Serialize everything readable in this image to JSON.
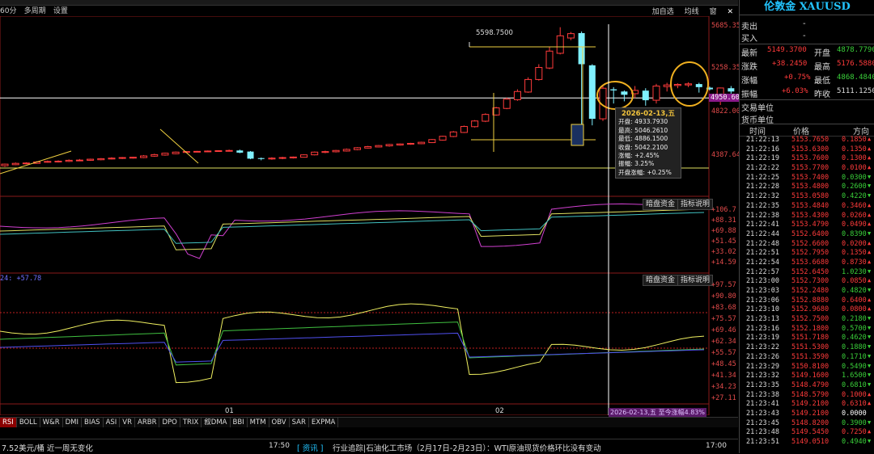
{
  "toolbar": {
    "period": "60分",
    "multi_period": "多周期",
    "settings": "设置",
    "add_select": "加自选",
    "ma_line": "均线",
    "window": "窗"
  },
  "quote": {
    "title": "伦敦金 XAUUSD",
    "sell_label": "卖出",
    "sell_value": "-",
    "buy_label": "买入",
    "buy_value": "-",
    "latest_label": "最新",
    "latest_value": "5149.3700",
    "open_label": "开盘",
    "open_value": "4878.7790",
    "change_label": "涨跌",
    "change_value": "+38.2450",
    "high_label": "最高",
    "high_value": "5176.5880",
    "pct_label": "涨幅",
    "pct_value": "+0.75%",
    "low_label": "最低",
    "low_value": "4868.4840",
    "amp_label": "振幅",
    "amp_value": "+6.03%",
    "prev_label": "昨收",
    "prev_value": "5111.1250",
    "unit_trade_label": "交易单位",
    "unit_currency_label": "货币单位"
  },
  "ticks_header": {
    "time": "时间",
    "price": "价格",
    "dir": "方向"
  },
  "ticks": [
    {
      "time": "21:22:13",
      "price": "5153.7650",
      "vol": "0.1850",
      "up": true
    },
    {
      "time": "21:22:16",
      "price": "5153.6300",
      "vol": "0.1350",
      "up": true
    },
    {
      "time": "21:22:19",
      "price": "5153.7600",
      "vol": "0.1300",
      "up": true
    },
    {
      "time": "21:22:22",
      "price": "5153.7700",
      "vol": "0.0100",
      "up": true
    },
    {
      "time": "21:22:25",
      "price": "5153.7400",
      "vol": "0.0300",
      "up": false
    },
    {
      "time": "21:22:28",
      "price": "5153.4800",
      "vol": "0.2600",
      "up": false
    },
    {
      "time": "21:22:32",
      "price": "5153.0580",
      "vol": "0.4220",
      "up": false
    },
    {
      "time": "21:22:35",
      "price": "5153.4840",
      "vol": "0.3460",
      "up": true
    },
    {
      "time": "21:22:38",
      "price": "5153.4300",
      "vol": "0.0260",
      "up": true
    },
    {
      "time": "21:22:41",
      "price": "5153.4790",
      "vol": "0.0490",
      "up": true
    },
    {
      "time": "21:22:44",
      "price": "5152.6400",
      "vol": "0.8390",
      "up": false
    },
    {
      "time": "21:22:48",
      "price": "5152.6600",
      "vol": "0.0200",
      "up": true
    },
    {
      "time": "21:22:51",
      "price": "5152.7950",
      "vol": "0.1350",
      "up": true
    },
    {
      "time": "21:22:54",
      "price": "5153.6680",
      "vol": "0.8730",
      "up": true
    },
    {
      "time": "21:22:57",
      "price": "5152.6450",
      "vol": "1.0230",
      "up": false
    },
    {
      "time": "21:23:00",
      "price": "5152.7300",
      "vol": "0.0850",
      "up": true
    },
    {
      "time": "21:23:03",
      "price": "5152.2480",
      "vol": "0.4820",
      "up": false
    },
    {
      "time": "21:23:06",
      "price": "5152.8880",
      "vol": "0.6400",
      "up": true
    },
    {
      "time": "21:23:10",
      "price": "5152.9680",
      "vol": "0.0800",
      "up": true
    },
    {
      "time": "21:23:13",
      "price": "5152.7500",
      "vol": "0.2180",
      "up": false
    },
    {
      "time": "21:23:16",
      "price": "5152.1800",
      "vol": "0.5700",
      "up": false
    },
    {
      "time": "21:23:19",
      "price": "5151.7180",
      "vol": "0.4620",
      "up": false
    },
    {
      "time": "21:23:22",
      "price": "5151.5300",
      "vol": "0.1880",
      "up": false
    },
    {
      "time": "21:23:26",
      "price": "5151.3590",
      "vol": "0.1710",
      "up": false
    },
    {
      "time": "21:23:29",
      "price": "5150.8100",
      "vol": "0.5490",
      "up": false
    },
    {
      "time": "21:23:32",
      "price": "5149.1600",
      "vol": "1.6500",
      "up": false
    },
    {
      "time": "21:23:35",
      "price": "5148.4790",
      "vol": "0.6810",
      "up": false
    },
    {
      "time": "21:23:38",
      "price": "5148.5790",
      "vol": "0.1000",
      "up": true
    },
    {
      "time": "21:23:41",
      "price": "5149.2100",
      "vol": "0.6310",
      "up": true
    },
    {
      "time": "21:23:43",
      "price": "5149.2100",
      "vol": "0.0000",
      "up": null
    },
    {
      "time": "21:23:45",
      "price": "5148.8200",
      "vol": "0.3900",
      "up": false
    },
    {
      "time": "21:23:48",
      "price": "5149.5450",
      "vol": "0.7250",
      "up": true
    },
    {
      "time": "21:23:51",
      "price": "5149.0510",
      "vol": "0.4940",
      "up": false
    }
  ],
  "price_axis": [
    "5685.353",
    "5258.356",
    "4950.605",
    "4822.001",
    "4387.643"
  ],
  "annotations": {
    "peak_label": "5598.7500"
  },
  "tooltip": {
    "date": "2026-02-13,五",
    "open": "开盘: 4933.7930",
    "high": "最高: 5046.2610",
    "low": "最低: 4886.1500",
    "close": "收盘: 5042.2100",
    "change": "涨幅: +2.45%",
    "amp": "振幅: 3.25%",
    "open_change": "开盘涨幅: +0.25%"
  },
  "panel2": {
    "btn1": "暗盘资金",
    "btn2": "指标说明",
    "axis": [
      "+106.7",
      "+88.31",
      "+69.88",
      "+51.45",
      "+33.02",
      "+14.59"
    ]
  },
  "panel3": {
    "btn1": "暗盘资金",
    "btn2": "指标说明",
    "label": "24: +57.78",
    "axis": [
      "+97.57",
      "+90.80",
      "+83.68",
      "+75.57",
      "+69.46",
      "+62.34",
      "+55.57",
      "+48.45",
      "+41.34",
      "+34.23",
      "+27.11"
    ]
  },
  "x_axis": {
    "l1": "01",
    "l2": "02",
    "cursor_label": "2026-02-13,五 至今涨幅4.83%"
  },
  "indicator_tabs": [
    "RSI",
    "BOLL",
    "W&R",
    "DMI",
    "BIAS",
    "ASI",
    "VR",
    "ARBR",
    "DPO",
    "TRIX",
    "叙DMA",
    "BBI",
    "MTM",
    "OBV",
    "SAR",
    "EXPMA"
  ],
  "news": {
    "left": "7.52美元/桶  近一周无变化",
    "time": "17:50",
    "tag": "[ 资讯 ]",
    "text": "行业追踪|石油化工市场（2月17日-2月23日）：WTI原油现货价格环比没有变动",
    "right_time": "17:00"
  },
  "colors": {
    "up": "#ff3b3b",
    "down": "#3ad13a",
    "bear_candle": "#7ff0ff",
    "accent": "#22c4ff",
    "yellow": "#f0d040",
    "purple": "#c040c0"
  },
  "chart_data": {
    "type": "candlestick",
    "title": "伦敦金 XAUUSD",
    "ylim": [
      4250,
      5700
    ],
    "candles": [
      [
        4330,
        4345,
        4320,
        4350
      ],
      [
        4340,
        4352,
        4335,
        4360
      ],
      [
        4348,
        4355,
        4345,
        4362
      ],
      [
        4352,
        4365,
        4348,
        4372
      ],
      [
        4362,
        4370,
        4358,
        4378
      ],
      [
        4368,
        4372,
        4360,
        4380
      ],
      [
        4370,
        4380,
        4365,
        4388
      ],
      [
        4378,
        4382,
        4372,
        4392
      ],
      [
        4380,
        4390,
        4375,
        4395
      ],
      [
        4385,
        4395,
        4380,
        4400
      ],
      [
        4392,
        4400,
        4388,
        4408
      ],
      [
        4398,
        4405,
        4392,
        4410
      ],
      [
        4400,
        4408,
        4395,
        4412
      ],
      [
        4405,
        4420,
        4400,
        4428
      ],
      [
        4418,
        4432,
        4412,
        4440
      ],
      [
        4428,
        4445,
        4422,
        4450
      ],
      [
        4440,
        4455,
        4435,
        4460
      ],
      [
        4452,
        4460,
        4448,
        4465
      ],
      [
        4458,
        4462,
        4455,
        4466
      ],
      [
        4460,
        4465,
        4455,
        4470
      ],
      [
        4462,
        4468,
        4458,
        4472
      ],
      [
        4465,
        4470,
        4460,
        4478
      ],
      [
        4470,
        4450,
        4445,
        4478
      ],
      [
        4460,
        4395,
        4390,
        4465
      ],
      [
        4400,
        4392,
        4380,
        4405
      ],
      [
        4392,
        4400,
        4385,
        4408
      ],
      [
        4398,
        4405,
        4390,
        4412
      ],
      [
        4402,
        4410,
        4396,
        4415
      ],
      [
        4408,
        4430,
        4405,
        4435
      ],
      [
        4430,
        4455,
        4425,
        4460
      ],
      [
        4452,
        4460,
        4445,
        4468
      ],
      [
        4458,
        4470,
        4452,
        4475
      ],
      [
        4465,
        4480,
        4460,
        4488
      ],
      [
        4478,
        4495,
        4472,
        4500
      ],
      [
        4492,
        4505,
        4488,
        4512
      ],
      [
        4502,
        4515,
        4498,
        4520
      ],
      [
        4512,
        4525,
        4505,
        4530
      ],
      [
        4520,
        4530,
        4515,
        4535
      ],
      [
        4528,
        4535,
        4522,
        4540
      ],
      [
        4532,
        4545,
        4528,
        4550
      ],
      [
        4542,
        4570,
        4538,
        4575
      ],
      [
        4565,
        4600,
        4560,
        4605
      ],
      [
        4598,
        4640,
        4592,
        4648
      ],
      [
        4635,
        4690,
        4630,
        4698
      ],
      [
        4688,
        4740,
        4680,
        4748
      ],
      [
        4738,
        4800,
        4730,
        4810
      ],
      [
        4795,
        4860,
        4788,
        4870
      ],
      [
        4855,
        4940,
        4848,
        4955
      ],
      [
        4935,
        5010,
        4925,
        5030
      ],
      [
        5005,
        5120,
        4998,
        5140
      ],
      [
        5120,
        5230,
        5110,
        5260
      ],
      [
        5225,
        5380,
        5215,
        5420
      ],
      [
        5360,
        5520,
        5350,
        5598.75
      ],
      [
        5500,
        5540,
        5480,
        5555
      ],
      [
        5545,
        5260,
        4620,
        5560
      ],
      [
        5250,
        4760,
        4700,
        5260
      ],
      [
        4760,
        5040,
        4740,
        5060
      ],
      [
        5030,
        5020,
        4900,
        5050
      ],
      [
        5010,
        4980,
        4920,
        5020
      ],
      [
        4990,
        5020,
        4950,
        5060
      ],
      [
        5018,
        4930,
        4880,
        5040
      ],
      [
        4930,
        5060,
        4900,
        5080
      ],
      [
        5055,
        5070,
        5010,
        5090
      ],
      [
        5065,
        5075,
        5040,
        5085
      ],
      [
        5070,
        5080,
        5050,
        5095
      ],
      [
        5078,
        5050,
        5000,
        5090
      ],
      [
        5045,
        5030,
        5020,
        5055
      ],
      [
        4933.793,
        5042.21,
        4886.15,
        5046.261
      ],
      [
        5040,
        5010,
        4990,
        5060
      ],
      [
        5010,
        5030,
        4990,
        5040
      ],
      [
        5030,
        5035,
        5020,
        5045
      ],
      [
        5035,
        5040,
        5030,
        5045
      ],
      [
        5040,
        5120,
        5030,
        5140
      ],
      [
        5110,
        5149.37,
        4868.48,
        5176.58
      ]
    ],
    "rsi_lines": {
      "fast": "yellow",
      "mid": "green",
      "slow": "blue"
    }
  }
}
